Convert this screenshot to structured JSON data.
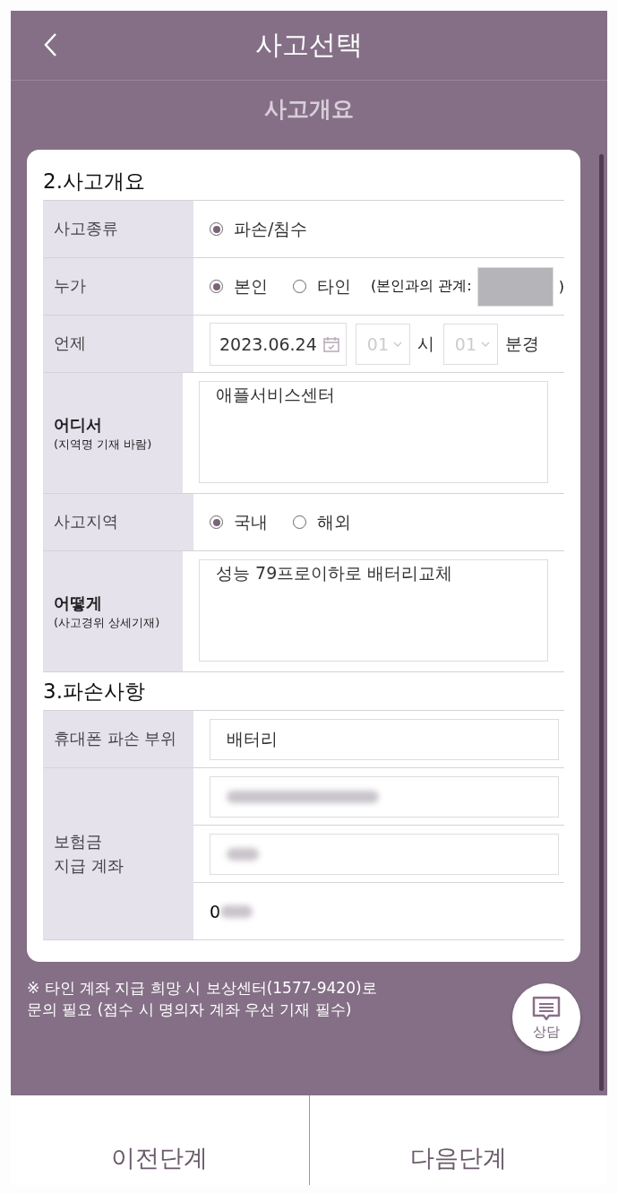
{
  "header": {
    "title": "사고선택"
  },
  "subheader": "사고개요",
  "sections": [
    {
      "title": "2.사고개요",
      "rows": [
        {
          "kind": "radio",
          "label": "사고종류",
          "options": [
            {
              "label": "파손/침수",
              "selected": true
            }
          ]
        },
        {
          "kind": "radio",
          "label": "누가",
          "options": [
            {
              "label": "본인",
              "selected": true
            },
            {
              "label": "타인",
              "selected": false
            }
          ],
          "relation": {
            "label": "(본인과의 관계:",
            "close": ")",
            "disabled": true
          }
        },
        {
          "kind": "datetime",
          "label": "언제",
          "date": "2023.06.24",
          "hour": "01",
          "hour_unit": "시",
          "minute": "01",
          "minute_unit": "분경",
          "time_disabled": true
        },
        {
          "kind": "textarea",
          "label": "어디서",
          "sublabel": "(지역명 기재 바람)",
          "value": "애플서비스센터"
        },
        {
          "kind": "radio",
          "label": "사고지역",
          "options": [
            {
              "label": "국내",
              "selected": true
            },
            {
              "label": "해외",
              "selected": false
            }
          ]
        },
        {
          "kind": "textarea",
          "label": "어떻게",
          "sublabel": "(사고경위 상세기재)",
          "value": "성능 79프로이하로 배터리교체"
        }
      ]
    },
    {
      "title": "3.파손사항",
      "rows": [
        {
          "kind": "text",
          "label": "휴대폰 파손 부위",
          "value": "배터리"
        },
        {
          "kind": "account",
          "label": "보험금\n지급 계좌",
          "lines": [
            {
              "kind": "field",
              "redacted": true
            },
            {
              "kind": "field",
              "redacted": true
            },
            {
              "kind": "plain",
              "value": "0",
              "redacted": true
            }
          ]
        }
      ]
    }
  ],
  "note": [
    "※ 타인 계좌 지급 희망 시 보상센터(1577-9420)로",
    "문의 필요 (접수 시 명의자 계좌 우선 기재 필수)"
  ],
  "chat_button": {
    "label": "상담"
  },
  "buttons": [
    "이전단계",
    "다음단계"
  ]
}
